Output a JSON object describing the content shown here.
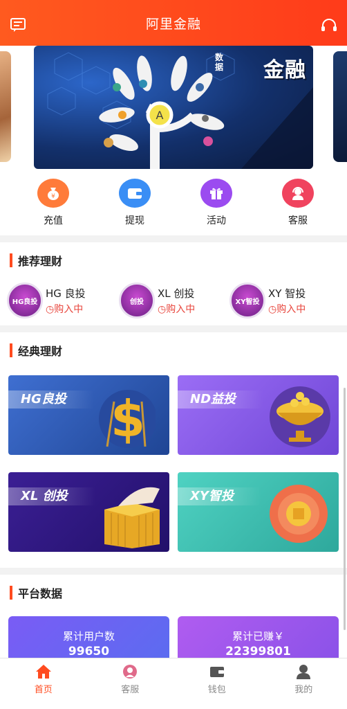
{
  "header": {
    "title": "阿里金融",
    "left_icon": "message-icon",
    "right_icon": "headset-icon"
  },
  "banner": {
    "brand": "金融",
    "brand_prefix": "数据",
    "node_letter": "A"
  },
  "quick_actions": [
    {
      "label": "充值",
      "icon": "money-bag-icon",
      "color": "#ff7b3a"
    },
    {
      "label": "提现",
      "icon": "wallet-icon",
      "color": "#3a8ef5"
    },
    {
      "label": "活动",
      "icon": "gift-icon",
      "color": "#9b4bf0"
    },
    {
      "label": "客服",
      "icon": "support-icon",
      "color": "#f0435e"
    }
  ],
  "recommend": {
    "title": "推荐理财",
    "items": [
      {
        "name": "HG 良投",
        "status": "购入中",
        "badge": "HG良投"
      },
      {
        "name": "XL 创投",
        "status": "购入中",
        "badge": "创投"
      },
      {
        "name": "XY 智投",
        "status": "购入中",
        "badge": "XY智投"
      }
    ]
  },
  "classic": {
    "title": "经典理财",
    "cards": [
      {
        "label": "HG良投",
        "bg": "#2f58b8"
      },
      {
        "label": "ND益投",
        "bg": "#8a5cf0"
      },
      {
        "label": "XL 创投",
        "bg": "#3a1f8c"
      },
      {
        "label": "XY智投",
        "bg": "#3cc3b6"
      }
    ]
  },
  "platform": {
    "title": "平台数据",
    "stats": [
      {
        "title": "累计用户数",
        "value": "99650"
      },
      {
        "title": "累计已赚￥",
        "value": "22399801"
      }
    ]
  },
  "nav": [
    {
      "label": "首页",
      "icon": "home-icon",
      "active": true
    },
    {
      "label": "客服",
      "icon": "support-icon",
      "active": false
    },
    {
      "label": "钱包",
      "icon": "wallet-icon",
      "active": false
    },
    {
      "label": "我的",
      "icon": "user-icon",
      "active": false
    }
  ]
}
